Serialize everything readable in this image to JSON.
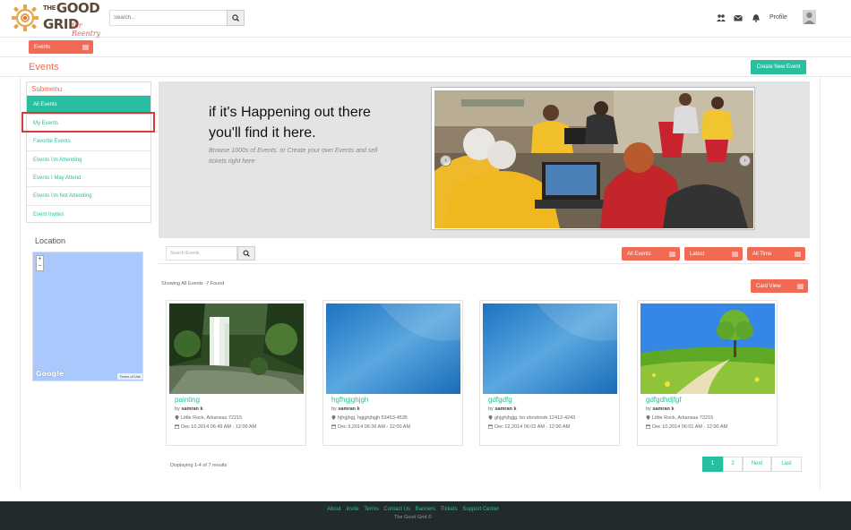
{
  "brand": {
    "logo_line1": "GOOD",
    "logo_the": "THE",
    "logo_line2": "GRID",
    "logo_tagline": "for Reentry"
  },
  "header": {
    "search_placeholder": "Search...",
    "profile_label": "Profile"
  },
  "module_selector": {
    "label": "Events"
  },
  "page": {
    "title": "Events",
    "create_button": "Create New Event"
  },
  "submenu": {
    "title": "Submenu",
    "items": [
      {
        "label": "All Events"
      },
      {
        "label": "My Events"
      },
      {
        "label": "Favorite Events"
      },
      {
        "label": "Events I'm Attending"
      },
      {
        "label": "Events I May Attend"
      },
      {
        "label": "Events I'm Not Attending"
      },
      {
        "label": "Event Invites"
      }
    ]
  },
  "location": {
    "label": "Location",
    "map_brand": "Google",
    "terms": "Terms of Use",
    "zoom_in": "+",
    "zoom_out": "−"
  },
  "hero": {
    "heading_line1": "if it's Happening out there",
    "heading_line2": "you'll find it here.",
    "subtext": "Browse 1000s of Events. or Create your own Events and sell tickets right here"
  },
  "filters": {
    "search_placeholder": "Search Events",
    "all_events": "All Events",
    "latest": "Latest",
    "all_time": "All Time"
  },
  "results": {
    "showing": "Showing All Events -7 Found",
    "view_mode": "Card View",
    "displaying": "Displaying 1-4 of 7 results"
  },
  "events": [
    {
      "title": "painting",
      "by_prefix": "by",
      "author": "samran k",
      "location": "Little Rock, Arkansas 72215",
      "datetime": "Dec 10,2014 06:49 AM - 12:00 AM"
    },
    {
      "title": "hgfhgjghjgh",
      "by_prefix": "by",
      "author": "samran k",
      "location": "hjhgjhgj, hgjghjhgjh 53453-4535",
      "datetime": "Dec 9,2014 06:36 AM - 12:00 AM"
    },
    {
      "title": "gdfgdfg",
      "by_prefix": "by",
      "author": "samran k",
      "location": "ghjghjhgjg, bn vbnvbnvb 12412-4243",
      "datetime": "Dec 12,2014 06:02 AM - 12:00 AM"
    },
    {
      "title": "gdfgdhdjfgf",
      "by_prefix": "by",
      "author": "samran k",
      "location": "Little Rock, Arkansas 72215",
      "datetime": "Dec 10,2014 06:01 AM - 12:00 AM"
    }
  ],
  "pagination": {
    "p1": "1",
    "p2": "2",
    "next": "Next",
    "last": "Last"
  },
  "footer": {
    "links": [
      "About",
      "Invite",
      "Terms",
      "Contact Us",
      "Banners",
      "Tickets",
      "Support Center"
    ],
    "copyright": "The Good Grid ©"
  },
  "colors": {
    "accent": "#27bfa0",
    "brand_red": "#f26a54",
    "footer_bg": "#222b2b"
  }
}
